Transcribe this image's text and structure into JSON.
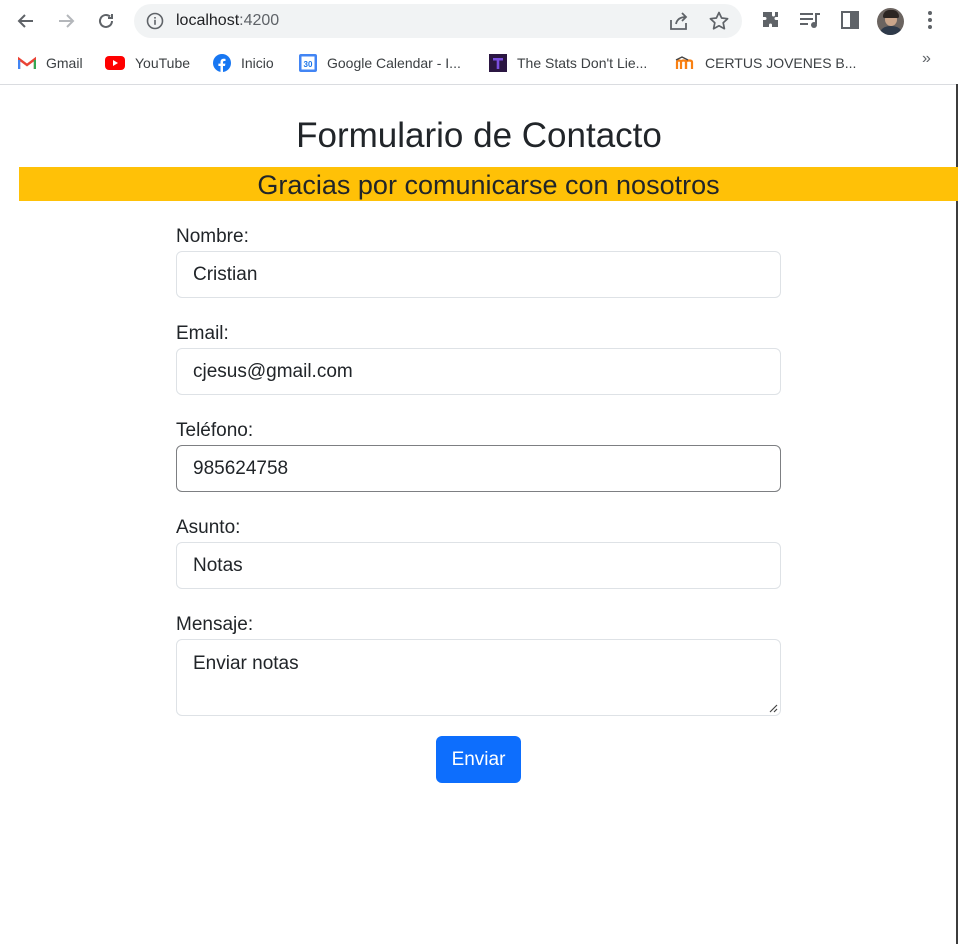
{
  "browser": {
    "url_host": "localhost",
    "url_port": ":4200",
    "bookmarks": [
      {
        "label": "Gmail",
        "icon": "gmail-icon"
      },
      {
        "label": "YouTube",
        "icon": "youtube-icon"
      },
      {
        "label": "Inicio",
        "icon": "facebook-icon"
      },
      {
        "label": "Google Calendar - I...",
        "icon": "calendar-icon"
      },
      {
        "label": "The Stats Don't Lie...",
        "icon": "stats-icon"
      },
      {
        "label": "CERTUS JOVENES B...",
        "icon": "moodle-icon"
      }
    ],
    "more_label": "»",
    "calendar_day": "30"
  },
  "page": {
    "title": "Formulario de Contacto",
    "banner": "Gracias por comunicarse con nosotros"
  },
  "form": {
    "nombre_label": "Nombre:",
    "nombre_value": "Cristian",
    "email_label": "Email:",
    "email_value": "cjesus@gmail.com",
    "telefono_label": "Teléfono:",
    "telefono_value": "985624758",
    "asunto_label": "Asunto:",
    "asunto_value": "Notas",
    "mensaje_label": "Mensaje:",
    "mensaje_value": "Enviar notas",
    "submit_label": "Enviar"
  },
  "colors": {
    "banner": "#ffc107",
    "button": "#0d6efd"
  }
}
